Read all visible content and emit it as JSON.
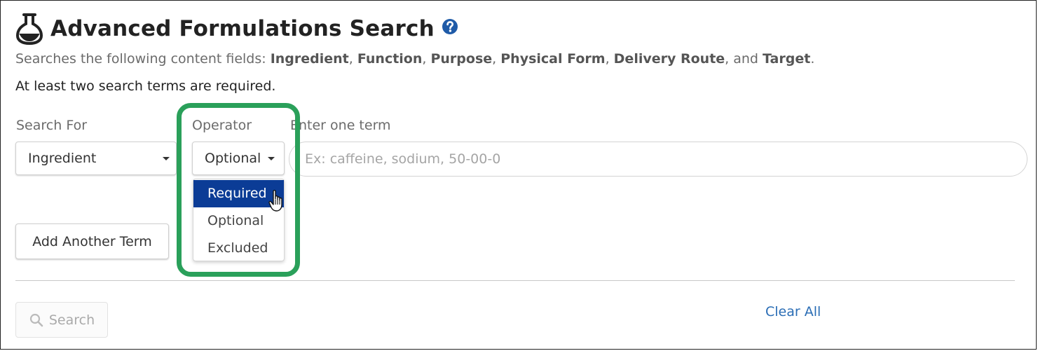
{
  "header": {
    "title": "Advanced Formulations Search",
    "icons": {
      "app": "flask-icon",
      "help": "help-circle-icon"
    }
  },
  "description": {
    "prefix": "Searches the following content fields: ",
    "fields": [
      "Ingredient",
      "Function",
      "Purpose",
      "Physical Form",
      "Delivery Route",
      "Target"
    ],
    "sep": ", ",
    "and": ", and ",
    "end": "."
  },
  "requirement_note": "At least two search terms are required.",
  "form": {
    "search_for_label": "Search For",
    "search_for_value": "Ingredient",
    "operator_label": "Operator",
    "operator_value": "Optional",
    "term_label": "Enter one term",
    "term_placeholder": "Ex: caffeine, sodium, 50-00-0",
    "term_value": ""
  },
  "operator_menu": {
    "options": [
      "Required",
      "Optional",
      "Excluded"
    ],
    "hovered": "Required"
  },
  "buttons": {
    "add_term": "Add Another Term",
    "search": "Search",
    "clear_all": "Clear All"
  },
  "colors": {
    "highlight": "#2aa05a",
    "menu_active": "#0b3c96",
    "link": "#2a6db5",
    "help_icon": "#1f5ba8"
  }
}
